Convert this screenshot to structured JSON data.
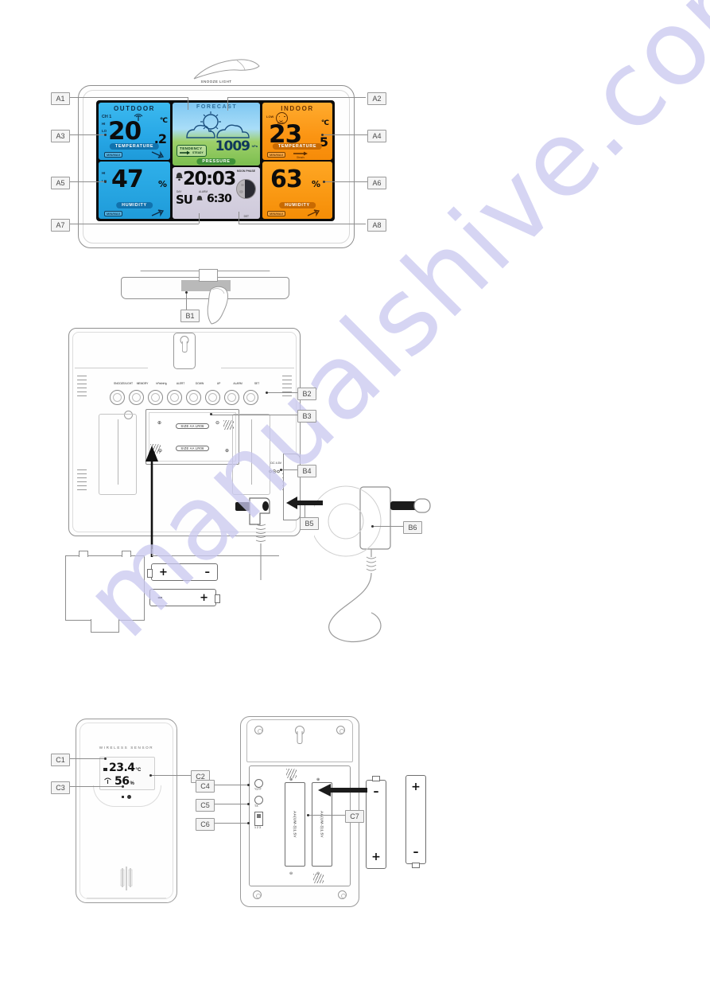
{
  "page": {
    "watermark": "manualshive.com",
    "doc_type": "weather station illustrated parts diagram"
  },
  "main_unit_front": {
    "snooze_light_label": "SNOOZE LIGHT",
    "callouts": [
      {
        "id": "A1",
        "side": "left"
      },
      {
        "id": "A2",
        "side": "right"
      },
      {
        "id": "A3",
        "side": "left"
      },
      {
        "id": "A4",
        "side": "right"
      },
      {
        "id": "A5",
        "side": "left"
      },
      {
        "id": "A6",
        "side": "right"
      },
      {
        "id": "A7",
        "side": "left"
      },
      {
        "id": "A8",
        "side": "right"
      }
    ],
    "lcd": {
      "outdoor": {
        "title": "OUTDOOR",
        "channel": "CH 1",
        "temperature_main": "20",
        "temperature_decimal": ".2",
        "temperature_unit": "°C",
        "temperature_caption": "TEMPERATURE",
        "temperature_minmax": "MIN/MAX",
        "temperature_trend": "Falling",
        "humidity_value": "47",
        "humidity_unit": "%",
        "humidity_caption": "HUMIDITY",
        "humidity_minmax": "MIN/MAX",
        "humidity_trend": "Rising",
        "rx_icon": "antenna-icon",
        "limit_hi": "HI",
        "limit_lo": "LO"
      },
      "forecast": {
        "title": "FORECAST",
        "weather_icon": "sun-behind-clouds-icon",
        "tendency_label": "TENDENCY",
        "tendency_state": "STEADY",
        "pressure_value": "1009",
        "pressure_unit": "hPa",
        "pressure_caption": "PRESSURE"
      },
      "indoor": {
        "title": "INDOOR",
        "comfort_icon": "comfort-face-icon",
        "comfort_lo": "LOW",
        "comfort_hi": "HIGH",
        "temperature_main": "23",
        "temperature_decimal": ".5",
        "temperature_unit": "°C",
        "temperature_caption": "TEMPERATURE",
        "temperature_minmax": "MIN/MAX",
        "temperature_trend": "Steady",
        "humidity_value": "63",
        "humidity_unit": "%",
        "humidity_caption": "HUMIDITY",
        "humidity_minmax": "MIN/MAX",
        "humidity_trend": "Rising"
      },
      "clock": {
        "alarm_icon": "alarm-bell-icon",
        "time": "20:03",
        "day_label": "DAY",
        "day_value": "SU",
        "alarm_label": "ALARM",
        "alarm_time": "6:30",
        "moon_label": "MOON PHASE",
        "moon_icon": "moon-phase-icon",
        "dst_label": "DST"
      }
    }
  },
  "top_view": {
    "callouts": [
      {
        "id": "B1"
      }
    ],
    "finger_icon": "pressing-finger-icon"
  },
  "main_unit_back": {
    "callouts": [
      {
        "id": "B2"
      },
      {
        "id": "B3"
      },
      {
        "id": "B4"
      },
      {
        "id": "B5"
      },
      {
        "id": "B6"
      }
    ],
    "buttons": [
      {
        "label": "SNOOZE/LIGHT"
      },
      {
        "label": "MEMORY"
      },
      {
        "label": "hPa/inHg"
      },
      {
        "label": "ALERT"
      },
      {
        "label": "DOWN"
      },
      {
        "label": "UP"
      },
      {
        "label": "ALARM"
      },
      {
        "label": "SET"
      }
    ],
    "battery_compartment": {
      "slot_top_label": "SIZE AA LR06",
      "slot_bottom_label": "SIZE AA LR06",
      "top_plus": "⊕",
      "top_minus": "⊖",
      "bottom_plus": "⊕",
      "bottom_minus": "⊖"
    },
    "dc_jack_label": "DC 4.5V",
    "loose_batteries": [
      {
        "left_pole": "+",
        "right_pole": "–"
      },
      {
        "left_pole": "–",
        "right_pole": "+"
      }
    ]
  },
  "power_adapter": {
    "callout": "B6",
    "plug_icon": "eu-mains-plug-icon",
    "cable_icon": "dc-cable-icon"
  },
  "wireless_sensor_front": {
    "brand_text": "WIRELESS SENSOR",
    "callouts": [
      {
        "id": "C1"
      },
      {
        "id": "C2"
      },
      {
        "id": "C3"
      }
    ],
    "display": {
      "temperature": "23.4",
      "temperature_unit": "°C",
      "humidity": "56",
      "humidity_unit": "%",
      "rx_icon": "antenna-icon"
    },
    "leds": [
      "led-indicator",
      "led-indicator"
    ]
  },
  "wireless_sensor_back": {
    "callouts": [
      {
        "id": "C4"
      },
      {
        "id": "C5"
      },
      {
        "id": "C6"
      },
      {
        "id": "C7"
      }
    ],
    "controls": [
      {
        "label": "°C/°F",
        "type": "button"
      },
      {
        "label": "TX",
        "type": "button"
      },
      {
        "label": "CH",
        "type": "slide-switch",
        "options": "1 2 3"
      }
    ],
    "battery_label": "AA(UM-3)1.5V",
    "loose_batteries": [
      {
        "top_pole": "–",
        "bottom_pole": "+"
      },
      {
        "top_pole": "+",
        "bottom_pole": "–"
      }
    ]
  }
}
